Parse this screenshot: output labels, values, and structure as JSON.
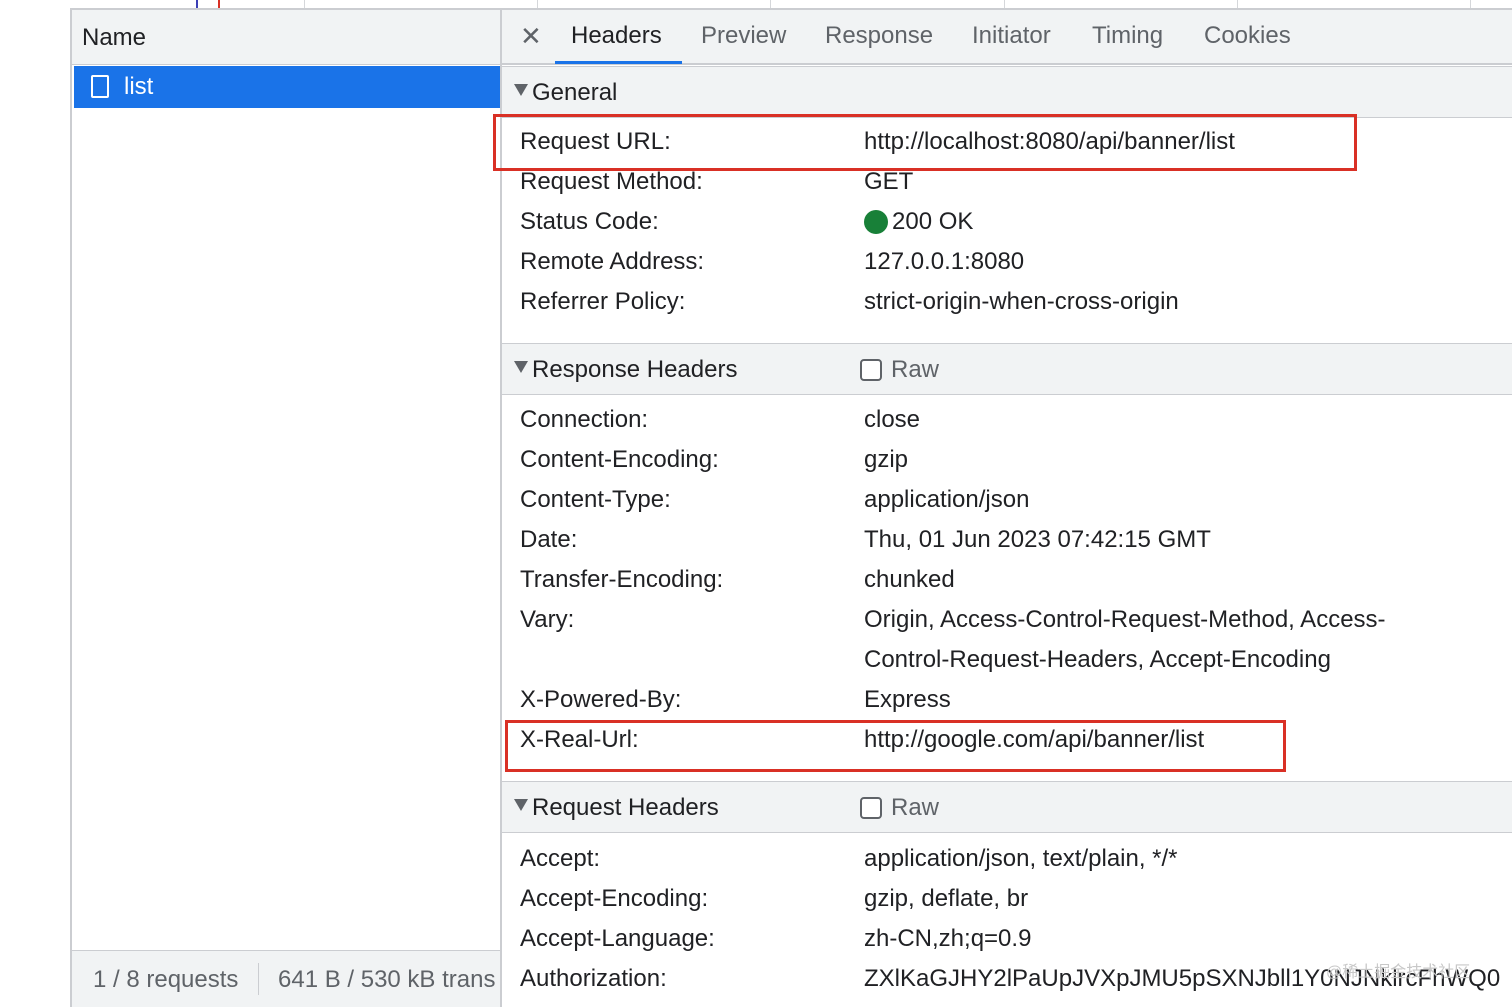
{
  "left_panel": {
    "column_header": "Name",
    "requests": [
      {
        "name": "list",
        "selected": true
      }
    ],
    "status": {
      "request_count": "1 / 8 requests",
      "transfer": "641 B / 530 kB trans"
    }
  },
  "tabs": [
    "Headers",
    "Preview",
    "Response",
    "Initiator",
    "Timing",
    "Cookies"
  ],
  "active_tab": "Headers",
  "general": {
    "title": "General",
    "rows": [
      {
        "key": "Request URL:",
        "value": "http://localhost:8080/api/banner/list"
      },
      {
        "key": "Request Method:",
        "value": "GET"
      },
      {
        "key": "Status Code:",
        "value": "200 OK",
        "status_color": "#188038"
      },
      {
        "key": "Remote Address:",
        "value": "127.0.0.1:8080"
      },
      {
        "key": "Referrer Policy:",
        "value": "strict-origin-when-cross-origin"
      }
    ]
  },
  "response_headers": {
    "title": "Response Headers",
    "raw_label": "Raw",
    "raw_checked": false,
    "rows": [
      {
        "key": "Connection:",
        "value": "close"
      },
      {
        "key": "Content-Encoding:",
        "value": "gzip"
      },
      {
        "key": "Content-Type:",
        "value": "application/json"
      },
      {
        "key": "Date:",
        "value": "Thu, 01 Jun 2023 07:42:15 GMT"
      },
      {
        "key": "Transfer-Encoding:",
        "value": "chunked"
      },
      {
        "key": "Vary:",
        "value": "Origin, Access-Control-Request-Method, Access-",
        "value_line2": "Control-Request-Headers, Accept-Encoding"
      },
      {
        "key": "X-Powered-By:",
        "value": "Express"
      },
      {
        "key": "X-Real-Url:",
        "value": "http://google.com/api/banner/list"
      }
    ]
  },
  "request_headers": {
    "title": "Request Headers",
    "raw_label": "Raw",
    "raw_checked": false,
    "rows": [
      {
        "key": "Accept:",
        "value": "application/json, text/plain, */*"
      },
      {
        "key": "Accept-Encoding:",
        "value": "gzip, deflate, br"
      },
      {
        "key": "Accept-Language:",
        "value": "zh-CN,zh;q=0.9"
      },
      {
        "key": "Authorization:",
        "value": "ZXlKaGJHY2lPaUpJVXpJMU5pSXNJbll1Y0NJNklrcFhWQ0"
      }
    ]
  },
  "colors": {
    "accent": "#1a73e8",
    "highlight": "#d93025",
    "status_ok": "#188038"
  },
  "watermark": "@稀土掘金技术社区"
}
